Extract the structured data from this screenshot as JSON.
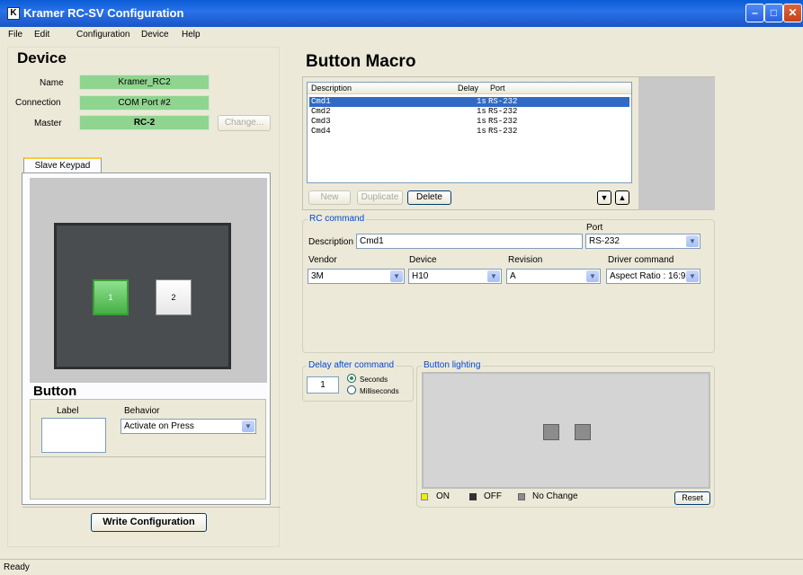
{
  "window": {
    "title": "Kramer RC-SV Configuration",
    "app_icon_letter": "K"
  },
  "titlebar_buttons": {
    "minimize": "–",
    "maximize": "□",
    "close": "✕"
  },
  "menu": [
    "File",
    "Edit",
    "Configuration",
    "Device",
    "Help"
  ],
  "device": {
    "heading": "Device",
    "name_label": "Name",
    "name_value": "Kramer_RC2",
    "connection_label": "Connection",
    "connection_value": "COM Port #2",
    "master_label": "Master",
    "master_value": "RC-2",
    "change_label": "Change..."
  },
  "keypad": {
    "tab_label": "Slave Keypad",
    "key1": "1",
    "key2": "2"
  },
  "button_section": {
    "heading": "Button",
    "label_caption": "Label",
    "behavior_caption": "Behavior",
    "behavior_value": "Activate on Press",
    "write_label": "Write Configuration"
  },
  "macro": {
    "heading": "Button Macro",
    "columns": [
      "Description",
      "Delay",
      "Port"
    ],
    "rows": [
      {
        "description": "Cmd1",
        "delay": "1s",
        "port": "RS-232",
        "selected": true
      },
      {
        "description": "Cmd2",
        "delay": "1s",
        "port": "RS-232",
        "selected": false
      },
      {
        "description": "Cmd3",
        "delay": "1s",
        "port": "RS-232",
        "selected": false
      },
      {
        "description": "Cmd4",
        "delay": "1s",
        "port": "RS-232",
        "selected": false
      }
    ],
    "new_label": "New",
    "duplicate_label": "Duplicate",
    "delete_label": "Delete",
    "move_down": "▼",
    "move_up": "▲"
  },
  "rc_command": {
    "group_title": "RC command",
    "description_label": "Description",
    "description_value": "Cmd1",
    "port_label": "Port",
    "port_value": "RS-232",
    "vendor_label": "Vendor",
    "vendor_value": "3M",
    "device_label": "Device",
    "device_value": "H10",
    "revision_label": "Revision",
    "revision_value": "A",
    "driver_label": "Driver command",
    "driver_value": "Aspect Ratio : 16:9"
  },
  "delay": {
    "group_title": "Delay after command",
    "value": "1",
    "seconds_label": "Seconds",
    "milliseconds_label": "Milliseconds",
    "selected": "seconds"
  },
  "lighting": {
    "group_title": "Button lighting",
    "on_label": "ON",
    "off_label": "OFF",
    "nochange_label": "No Change",
    "reset_label": "Reset"
  },
  "colors": {
    "on": "#f0f000",
    "off": "#333333",
    "nochange": "#8c8c8c",
    "selected_row": "#316ac5",
    "green_field": "#8fd48f"
  },
  "status": {
    "text": "Ready"
  }
}
